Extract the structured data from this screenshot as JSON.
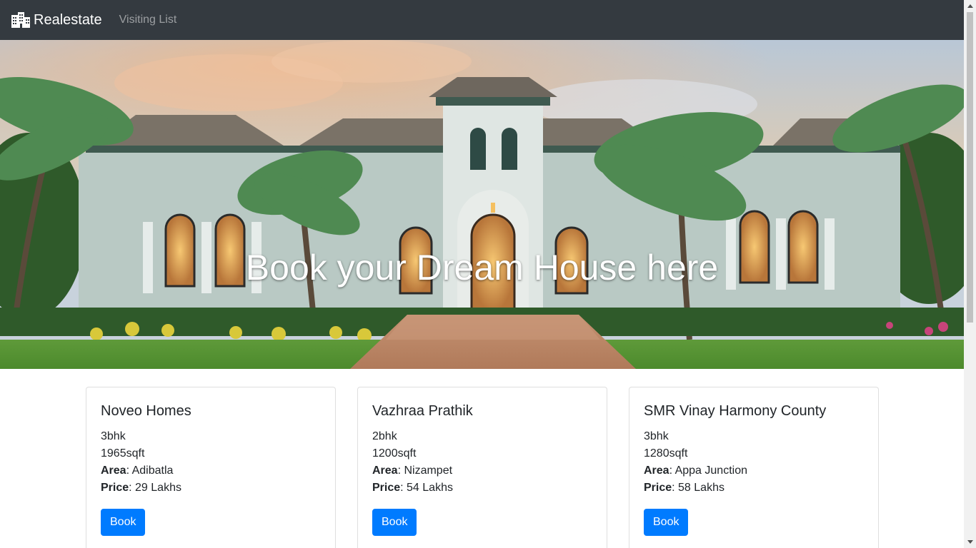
{
  "navbar": {
    "brand_label": "Realestate",
    "brand_icon": "building-icon",
    "links": [
      {
        "label": "Visiting List"
      }
    ],
    "colors": {
      "background": "#343a40"
    }
  },
  "hero": {
    "title": "Book your Dream House here"
  },
  "properties": [
    {
      "name": "Noveo Homes",
      "bhk": "3bhk",
      "size": "1965sqft",
      "area_label": "Area",
      "area": ": Adibatla",
      "price_label": "Price",
      "price": ": 29 Lakhs",
      "button": "Book"
    },
    {
      "name": "Vazhraa Prathik",
      "bhk": "2bhk",
      "size": "1200sqft",
      "area_label": "Area",
      "area": ": Nizampet",
      "price_label": "Price",
      "price": ": 54 Lakhs",
      "button": "Book"
    },
    {
      "name": "SMR Vinay Harmony County",
      "bhk": "3bhk",
      "size": "1280sqft",
      "area_label": "Area",
      "area": ": Appa Junction",
      "price_label": "Price",
      "price": ": 58 Lakhs",
      "button": "Book"
    }
  ],
  "colors": {
    "primary": "#007bff"
  }
}
